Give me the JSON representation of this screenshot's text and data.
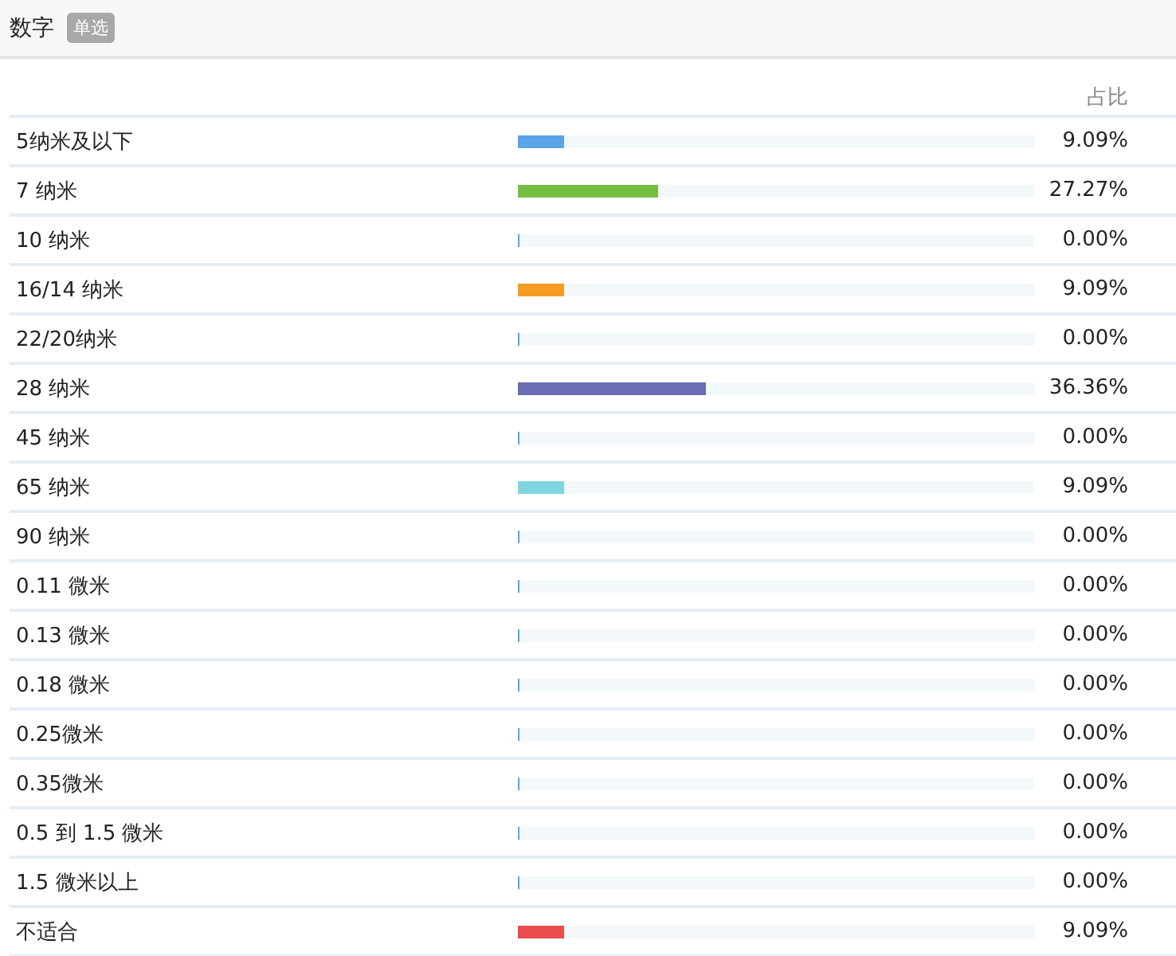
{
  "header": {
    "title": "数字",
    "tag": "单选"
  },
  "table": {
    "columns": {
      "share": "占比"
    },
    "rows": [
      {
        "label": "5纳米及以下",
        "level": 0.0909,
        "color": "#5aa5e8",
        "percent": "9.09%"
      },
      {
        "label": "7 纳米",
        "level": 0.2727,
        "color": "#78be44",
        "percent": "27.27%"
      },
      {
        "label": "10 纳米",
        "level": 0,
        "percent": "0.00%"
      },
      {
        "label": "16/14 纳米",
        "level": 0.0909,
        "color": "#f59c22",
        "percent": "9.09%"
      },
      {
        "label": "22/20纳米",
        "level": 0,
        "percent": "0.00%"
      },
      {
        "label": "28 纳米",
        "level": 0.3636,
        "color": "#6a6db3",
        "percent": "36.36%"
      },
      {
        "label": "45 纳米",
        "level": 0,
        "percent": "0.00%"
      },
      {
        "label": "65 纳米",
        "level": 0.0909,
        "color": "#7fd6df",
        "percent": "9.09%"
      },
      {
        "label": "90 纳米",
        "level": 0,
        "percent": "0.00%"
      },
      {
        "label": "0.11 微米",
        "level": 0,
        "percent": "0.00%"
      },
      {
        "label": "0.13 微米",
        "level": 0,
        "percent": "0.00%"
      },
      {
        "label": "0.18 微米",
        "level": 0,
        "percent": "0.00%"
      },
      {
        "label": "0.25微米",
        "level": 0,
        "percent": "0.00%"
      },
      {
        "label": "0.35微米",
        "level": 0,
        "percent": "0.00%"
      },
      {
        "label": "0.5 到 1.5 微米",
        "level": 0,
        "percent": "0.00%"
      },
      {
        "label": "1.5 微米以上",
        "level": 0,
        "percent": "0.00%"
      },
      {
        "label": "不适合",
        "level": 0.0909,
        "color": "#e84c4c",
        "percent": "9.09%"
      }
    ]
  }
}
